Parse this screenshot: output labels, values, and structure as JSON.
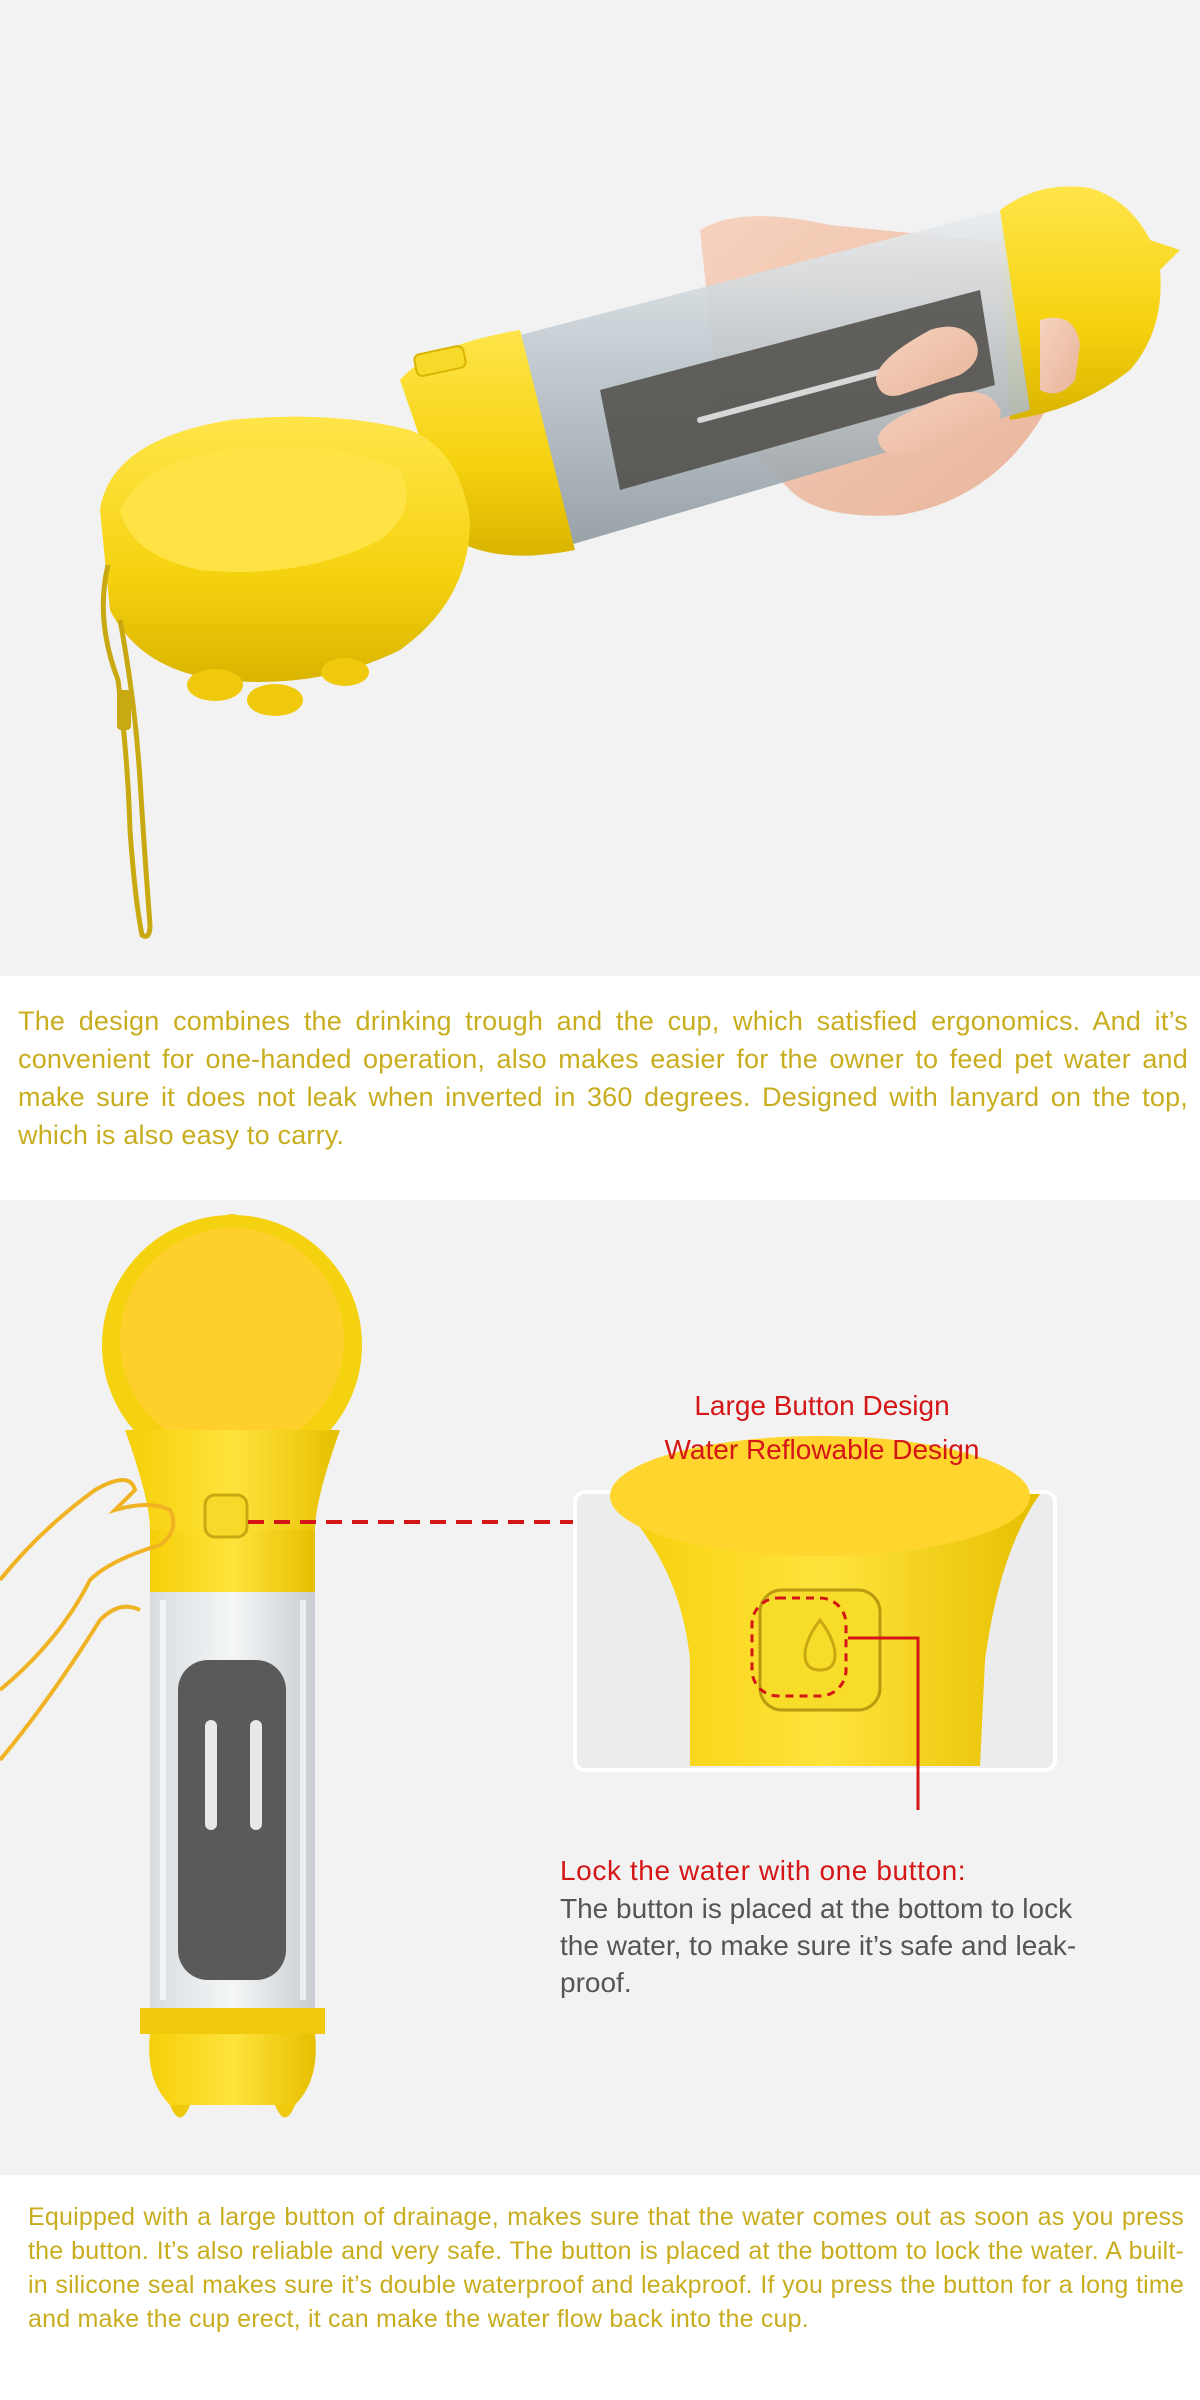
{
  "section_1": {
    "image_alt": "yellow-pet-water-bottle-held-in-hand",
    "description": "The design combines the drinking trough and the cup, which satisfied ergonomics. And it’s convenient for one-handed operation, also makes easier for the owner to feed pet water and make sure it does not leak when inverted in 360 degrees. Designed with lanyard on the top, which is also easy to carry."
  },
  "section_2": {
    "callouts": [
      "Large Button Design",
      "Water Reflowable Design"
    ],
    "lock": {
      "heading": "Lock the water with one button:",
      "body": "The button is placed at the bottom to lock the water, to make sure it’s safe and leak-proof."
    },
    "description": "Equipped with a large button of drainage, makes sure that the water comes out as soon as you press the button. It’s also reliable and very safe. The button is placed at the bottom to lock the water. A built-in silicone seal makes sure it’s double waterproof and leakproof. If you press the button for a long time and make the cup erect, it can make the water flow back into the cup."
  },
  "colors": {
    "brand_yellow": "#f5d20f",
    "text_gold": "#c8ad1e",
    "accent_red": "#d41616",
    "background": "#f2f2f2"
  }
}
